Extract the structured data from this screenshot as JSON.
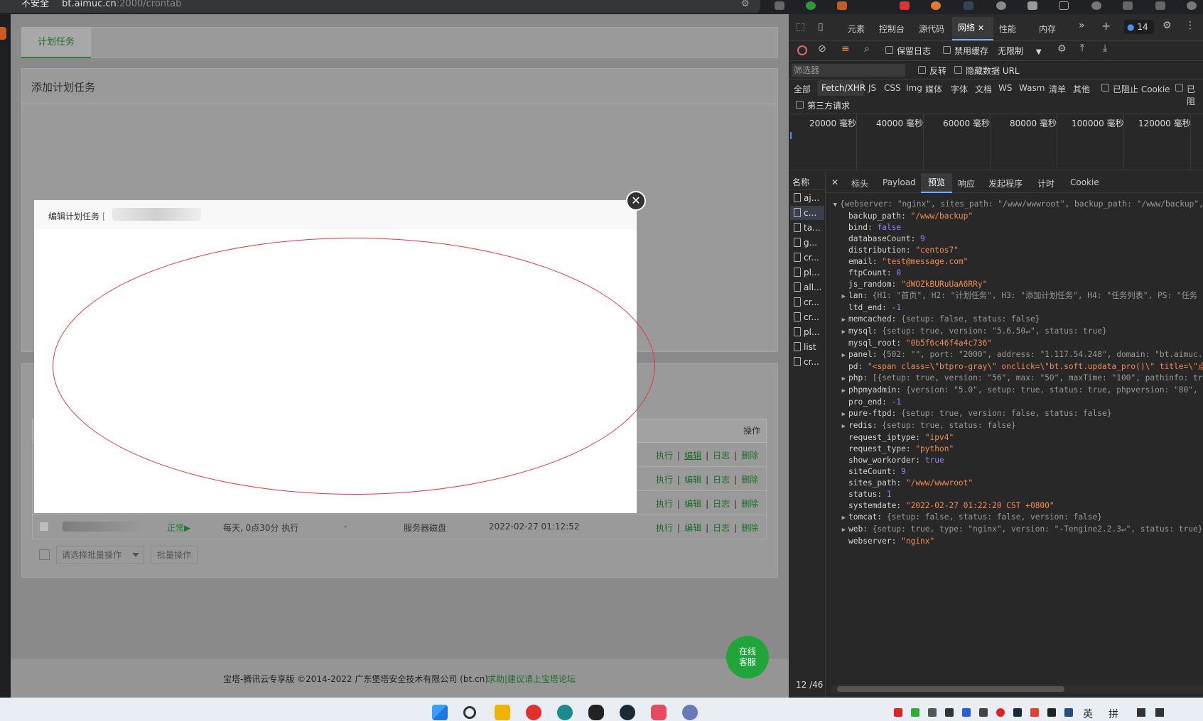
{
  "browser": {
    "security_label": "不安全",
    "url_host": "bt.aimuc.cn",
    "url_path": ":2000/crontab"
  },
  "page": {
    "tab_label": "计划任务",
    "add_title": "添加计划任务",
    "table_header_ops": "操作",
    "ops": {
      "exec": "执行",
      "edit": "编辑",
      "log": "日志",
      "delete": "删除",
      "sep": "|"
    },
    "last_row": {
      "status": "正常▶",
      "period": "每天, 0点30分 执行",
      "save": "-",
      "backup_to": "服务器磁盘",
      "added": "2022-02-27 01:12:52"
    },
    "batch_select_placeholder": "请选择批量操作",
    "batch_button": "批量操作",
    "footer_text": "宝塔-腾讯云专享版 ©2014-2022 广东堡塔安全技术有限公司 (bt.cn)",
    "footer_link": "求助|建议请上宝塔论坛",
    "online_service_line1": "在线",
    "online_service_line2": "客服"
  },
  "modal": {
    "title": "编辑计划任务",
    "title_suffix": "[",
    "close_glyph": "✕"
  },
  "devtools": {
    "tabs": [
      "元素",
      "控制台",
      "源代码",
      "网络",
      "性能",
      "内存"
    ],
    "active_tab_close": "✕",
    "issue_count": "14",
    "toolbar": {
      "preserve_log": "保留日志",
      "disable_cache": "禁用缓存",
      "throttle": "无限制"
    },
    "filter": {
      "placeholder": "筛选器",
      "invert": "反转",
      "hide_data_urls": "隐藏数据 URL"
    },
    "types": [
      "全部",
      "Fetch/XHR",
      "JS",
      "CSS",
      "Img",
      "媒体",
      "字体",
      "文档",
      "WS",
      "Wasm",
      "清单",
      "其他"
    ],
    "blocked_cookies": "已阻止 Cookie",
    "blocked_requests": "已阻",
    "third_party": "第三方请求",
    "timeline_labels": [
      "20000 毫秒",
      "40000 毫秒",
      "60000 毫秒",
      "80000 毫秒",
      "100000 毫秒",
      "120000 毫秒"
    ],
    "name_header": "名称",
    "requests": [
      "aj...",
      "c...",
      "ta...",
      "g...",
      "cr...",
      "pl...",
      "all...",
      "cr...",
      "cr...",
      "pl...",
      "list",
      "cr..."
    ],
    "counter": "12 /46",
    "detail_close": "✕",
    "detail_tabs": [
      "标头",
      "Payload",
      "预览",
      "响应",
      "发起程序",
      "计时",
      "Cookie"
    ]
  },
  "json_preview": [
    {
      "arrow": "▼",
      "indent": 0,
      "key": "",
      "value": "{webserver: \"nginx\", sites_path: \"/www/wwwroot\", backup_path: \"/www/backup\",",
      "type": "t"
    },
    {
      "arrow": "",
      "indent": 1,
      "key": "backup_path",
      "value": "\"/www/backup\"",
      "type": "s"
    },
    {
      "arrow": "",
      "indent": 1,
      "key": "bind",
      "value": "false",
      "type": "b"
    },
    {
      "arrow": "",
      "indent": 1,
      "key": "databaseCount",
      "value": "9",
      "type": "n"
    },
    {
      "arrow": "",
      "indent": 1,
      "key": "distribution",
      "value": "\"centos7\"",
      "type": "s"
    },
    {
      "arrow": "",
      "indent": 1,
      "key": "email",
      "value": "\"test@message.com\"",
      "type": "s"
    },
    {
      "arrow": "",
      "indent": 1,
      "key": "ftpCount",
      "value": "0",
      "type": "n"
    },
    {
      "arrow": "",
      "indent": 1,
      "key": "js_random",
      "value": "\"dWOZkBURuUaA6RRy\"",
      "type": "s"
    },
    {
      "arrow": "▶",
      "indent": 1,
      "key": "lan",
      "value": "{H1: \"首页\", H2: \"计划任务\", H3: \"添加计划任务\", H4: \"任务列表\", PS: \"任务",
      "type": "t"
    },
    {
      "arrow": "",
      "indent": 1,
      "key": "ltd_end",
      "value": "-1",
      "type": "n"
    },
    {
      "arrow": "▶",
      "indent": 1,
      "key": "memcached",
      "value": "{setup: false, status: false}",
      "type": "t"
    },
    {
      "arrow": "▶",
      "indent": 1,
      "key": "mysql",
      "value": "{setup: true, version: \"5.6.50↵\", status: true}",
      "type": "t"
    },
    {
      "arrow": "",
      "indent": 1,
      "key": "mysql_root",
      "value": "\"0b5f6c46f4a4c736\"",
      "type": "s"
    },
    {
      "arrow": "▶",
      "indent": 1,
      "key": "panel",
      "value": "{502: \"\", port: \"2000\", address: \"1.117.54.248\", domain: \"bt.aimuc.c",
      "type": "t"
    },
    {
      "arrow": "",
      "indent": 1,
      "key": "pd",
      "value": "\"<span class=\\\"btpro-gray\\\" onclick=\\\"bt.soft.updata_pro()\\\" title=\\\"点",
      "type": "s"
    },
    {
      "arrow": "▶",
      "indent": 1,
      "key": "php",
      "value": "[{setup: true, version: \"56\", max: \"50\", maxTime: \"100\", pathinfo: tru",
      "type": "t"
    },
    {
      "arrow": "▶",
      "indent": 1,
      "key": "phpmyadmin",
      "value": "{version: \"5.0\", setup: true, status: true, phpversion: \"80\", p",
      "type": "t"
    },
    {
      "arrow": "",
      "indent": 1,
      "key": "pro_end",
      "value": "-1",
      "type": "n"
    },
    {
      "arrow": "▶",
      "indent": 1,
      "key": "pure-ftpd",
      "value": "{setup: true, version: false, status: false}",
      "type": "t"
    },
    {
      "arrow": "▶",
      "indent": 1,
      "key": "redis",
      "value": "{setup: true, status: false}",
      "type": "t"
    },
    {
      "arrow": "",
      "indent": 1,
      "key": "request_iptype",
      "value": "\"ipv4\"",
      "type": "s"
    },
    {
      "arrow": "",
      "indent": 1,
      "key": "request_type",
      "value": "\"python\"",
      "type": "s"
    },
    {
      "arrow": "",
      "indent": 1,
      "key": "show_workorder",
      "value": "true",
      "type": "b"
    },
    {
      "arrow": "",
      "indent": 1,
      "key": "siteCount",
      "value": "9",
      "type": "n"
    },
    {
      "arrow": "",
      "indent": 1,
      "key": "sites_path",
      "value": "\"/www/wwwroot\"",
      "type": "s"
    },
    {
      "arrow": "",
      "indent": 1,
      "key": "status",
      "value": "1",
      "type": "n"
    },
    {
      "arrow": "",
      "indent": 1,
      "key": "systemdate",
      "value": "\"2022-02-27 01:22:20 CST +0800\"",
      "type": "s"
    },
    {
      "arrow": "▶",
      "indent": 1,
      "key": "tomcat",
      "value": "{setup: false, status: false, version: false}",
      "type": "t"
    },
    {
      "arrow": "▶",
      "indent": 1,
      "key": "web",
      "value": "{setup: true, type: \"nginx\", version: \"-Tengine2.2.3↵\", status: true}",
      "type": "t"
    },
    {
      "arrow": "",
      "indent": 1,
      "key": "webserver",
      "value": "\"nginx\"",
      "type": "s"
    }
  ],
  "taskbar": {
    "ime_lang": "英",
    "ime_mode": "拼"
  }
}
